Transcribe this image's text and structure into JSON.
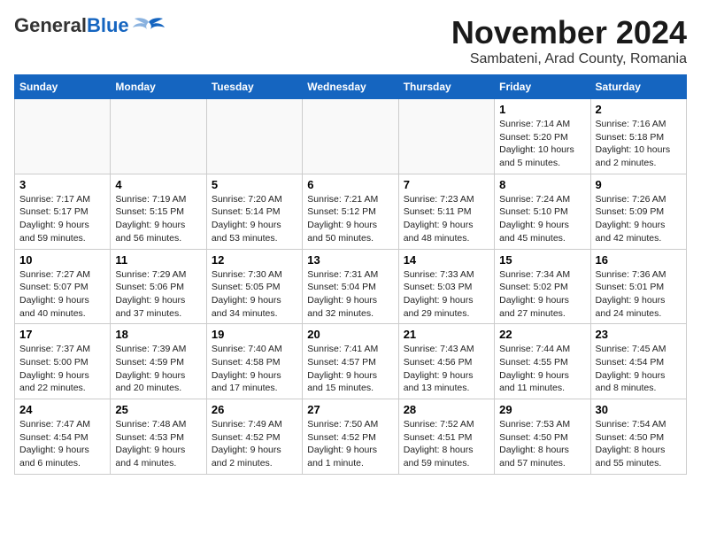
{
  "header": {
    "logo_general": "General",
    "logo_blue": "Blue",
    "month_title": "November 2024",
    "location": "Sambateni, Arad County, Romania"
  },
  "weekdays": [
    "Sunday",
    "Monday",
    "Tuesday",
    "Wednesday",
    "Thursday",
    "Friday",
    "Saturday"
  ],
  "weeks": [
    [
      {
        "day": "",
        "info": ""
      },
      {
        "day": "",
        "info": ""
      },
      {
        "day": "",
        "info": ""
      },
      {
        "day": "",
        "info": ""
      },
      {
        "day": "",
        "info": ""
      },
      {
        "day": "1",
        "info": "Sunrise: 7:14 AM\nSunset: 5:20 PM\nDaylight: 10 hours\nand 5 minutes."
      },
      {
        "day": "2",
        "info": "Sunrise: 7:16 AM\nSunset: 5:18 PM\nDaylight: 10 hours\nand 2 minutes."
      }
    ],
    [
      {
        "day": "3",
        "info": "Sunrise: 7:17 AM\nSunset: 5:17 PM\nDaylight: 9 hours\nand 59 minutes."
      },
      {
        "day": "4",
        "info": "Sunrise: 7:19 AM\nSunset: 5:15 PM\nDaylight: 9 hours\nand 56 minutes."
      },
      {
        "day": "5",
        "info": "Sunrise: 7:20 AM\nSunset: 5:14 PM\nDaylight: 9 hours\nand 53 minutes."
      },
      {
        "day": "6",
        "info": "Sunrise: 7:21 AM\nSunset: 5:12 PM\nDaylight: 9 hours\nand 50 minutes."
      },
      {
        "day": "7",
        "info": "Sunrise: 7:23 AM\nSunset: 5:11 PM\nDaylight: 9 hours\nand 48 minutes."
      },
      {
        "day": "8",
        "info": "Sunrise: 7:24 AM\nSunset: 5:10 PM\nDaylight: 9 hours\nand 45 minutes."
      },
      {
        "day": "9",
        "info": "Sunrise: 7:26 AM\nSunset: 5:09 PM\nDaylight: 9 hours\nand 42 minutes."
      }
    ],
    [
      {
        "day": "10",
        "info": "Sunrise: 7:27 AM\nSunset: 5:07 PM\nDaylight: 9 hours\nand 40 minutes."
      },
      {
        "day": "11",
        "info": "Sunrise: 7:29 AM\nSunset: 5:06 PM\nDaylight: 9 hours\nand 37 minutes."
      },
      {
        "day": "12",
        "info": "Sunrise: 7:30 AM\nSunset: 5:05 PM\nDaylight: 9 hours\nand 34 minutes."
      },
      {
        "day": "13",
        "info": "Sunrise: 7:31 AM\nSunset: 5:04 PM\nDaylight: 9 hours\nand 32 minutes."
      },
      {
        "day": "14",
        "info": "Sunrise: 7:33 AM\nSunset: 5:03 PM\nDaylight: 9 hours\nand 29 minutes."
      },
      {
        "day": "15",
        "info": "Sunrise: 7:34 AM\nSunset: 5:02 PM\nDaylight: 9 hours\nand 27 minutes."
      },
      {
        "day": "16",
        "info": "Sunrise: 7:36 AM\nSunset: 5:01 PM\nDaylight: 9 hours\nand 24 minutes."
      }
    ],
    [
      {
        "day": "17",
        "info": "Sunrise: 7:37 AM\nSunset: 5:00 PM\nDaylight: 9 hours\nand 22 minutes."
      },
      {
        "day": "18",
        "info": "Sunrise: 7:39 AM\nSunset: 4:59 PM\nDaylight: 9 hours\nand 20 minutes."
      },
      {
        "day": "19",
        "info": "Sunrise: 7:40 AM\nSunset: 4:58 PM\nDaylight: 9 hours\nand 17 minutes."
      },
      {
        "day": "20",
        "info": "Sunrise: 7:41 AM\nSunset: 4:57 PM\nDaylight: 9 hours\nand 15 minutes."
      },
      {
        "day": "21",
        "info": "Sunrise: 7:43 AM\nSunset: 4:56 PM\nDaylight: 9 hours\nand 13 minutes."
      },
      {
        "day": "22",
        "info": "Sunrise: 7:44 AM\nSunset: 4:55 PM\nDaylight: 9 hours\nand 11 minutes."
      },
      {
        "day": "23",
        "info": "Sunrise: 7:45 AM\nSunset: 4:54 PM\nDaylight: 9 hours\nand 8 minutes."
      }
    ],
    [
      {
        "day": "24",
        "info": "Sunrise: 7:47 AM\nSunset: 4:54 PM\nDaylight: 9 hours\nand 6 minutes."
      },
      {
        "day": "25",
        "info": "Sunrise: 7:48 AM\nSunset: 4:53 PM\nDaylight: 9 hours\nand 4 minutes."
      },
      {
        "day": "26",
        "info": "Sunrise: 7:49 AM\nSunset: 4:52 PM\nDaylight: 9 hours\nand 2 minutes."
      },
      {
        "day": "27",
        "info": "Sunrise: 7:50 AM\nSunset: 4:52 PM\nDaylight: 9 hours\nand 1 minute."
      },
      {
        "day": "28",
        "info": "Sunrise: 7:52 AM\nSunset: 4:51 PM\nDaylight: 8 hours\nand 59 minutes."
      },
      {
        "day": "29",
        "info": "Sunrise: 7:53 AM\nSunset: 4:50 PM\nDaylight: 8 hours\nand 57 minutes."
      },
      {
        "day": "30",
        "info": "Sunrise: 7:54 AM\nSunset: 4:50 PM\nDaylight: 8 hours\nand 55 minutes."
      }
    ]
  ]
}
